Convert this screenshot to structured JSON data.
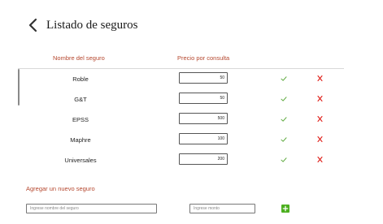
{
  "header": {
    "title": "Listado de seguros",
    "back_icon": "chevron-left-icon"
  },
  "table": {
    "columns": {
      "name": "Nombre del seguro",
      "price": "Precio por consulta"
    },
    "rows": [
      {
        "name": "Roble",
        "price": "50"
      },
      {
        "name": "G&T",
        "price": "50"
      },
      {
        "name": "EPSS",
        "price": "500"
      },
      {
        "name": "Maphre",
        "price": "100"
      },
      {
        "name": "Universales",
        "price": "200"
      }
    ],
    "confirm_icon": "check-icon",
    "delete_icon": "close-icon"
  },
  "add_form": {
    "title": "Agregar un nuevo seguro",
    "name_placeholder": "Ingrese nombre del seguro",
    "amount_placeholder": "Ingrese monto",
    "add_icon": "plus-icon"
  },
  "colors": {
    "accent": "#b5472e",
    "check": "#5aa83a",
    "cross": "#e0201b",
    "add_button": "#4caf1f"
  }
}
